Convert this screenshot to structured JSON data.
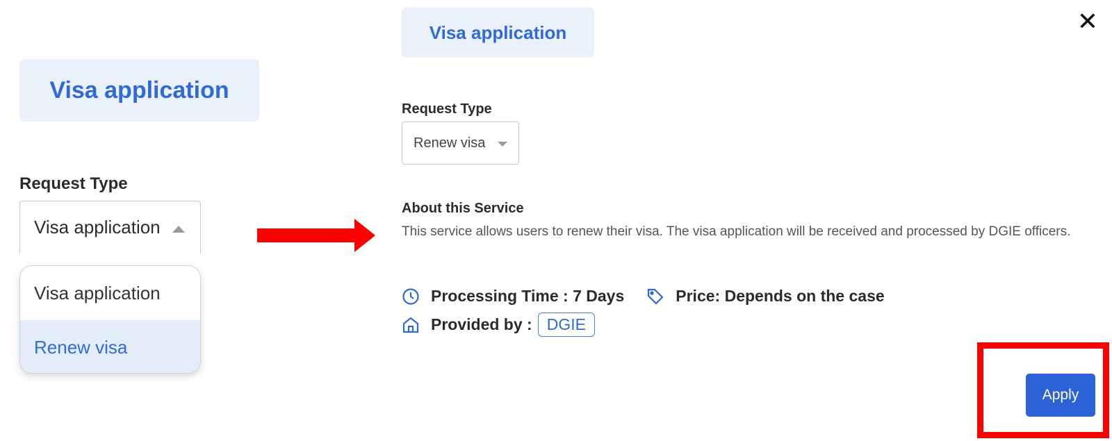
{
  "left": {
    "title": "Visa application",
    "request_type_label": "Request Type",
    "select_value": "Visa application",
    "dropdown_options": [
      "Visa application",
      "Renew visa"
    ]
  },
  "right": {
    "title": "Visa application",
    "request_type_label": "Request Type",
    "select_value": "Renew visa",
    "about_heading": "About this Service",
    "about_description": "This service allows users to renew their visa. The visa application will be received and processed by DGIE officers.",
    "processing_time": "Processing Time : 7 Days",
    "price": "Price: Depends on the case",
    "provided_by_label": "Provided by :",
    "provider": "DGIE",
    "apply_label": "Apply",
    "close_glyph": "✕"
  },
  "colors": {
    "accent": "#2f6ad6",
    "title_bg": "#eaf1fb",
    "apply_bg": "#2c62d6",
    "annotation": "#ff0000"
  },
  "icons": [
    "clock-icon",
    "tag-icon",
    "home-icon",
    "close-icon",
    "chevron-up-icon",
    "chevron-down-icon",
    "red-arrow"
  ]
}
